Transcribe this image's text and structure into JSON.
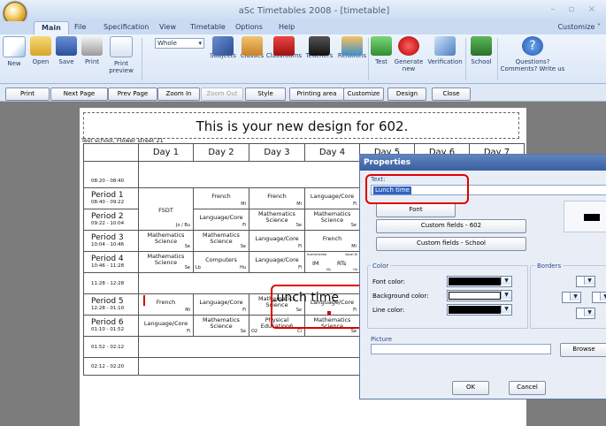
{
  "window": {
    "title": "aSc Timetables 2008  - [timetable]",
    "controls": "– ▫ ×"
  },
  "ribbon": {
    "tabs": [
      "Main",
      "File",
      "Specification",
      "View",
      "Timetable",
      "Options",
      "Help"
    ],
    "customize": "Customize ˅",
    "view_select": "Whole",
    "buttons": {
      "new": "New",
      "open": "Open",
      "save": "Save",
      "print": "Print",
      "print_preview": "Print preview",
      "subjects": "Subjects",
      "classes": "Classes",
      "classrooms": "Classrooms",
      "teachers": "Teachers",
      "relations": "Relations",
      "test": "Test",
      "generate_new": "Generate new",
      "verification": "Verification",
      "school": "School",
      "questions": "Questions? Comments? Write us"
    }
  },
  "print_toolbar": {
    "print": "Print",
    "next": "Next Page",
    "prev": "Prev Page",
    "zoom_in": "Zoom In",
    "zoom_out": "Zoom Out",
    "style": "Style",
    "printing_area": "Printing area",
    "customize": "Customize",
    "design": "Design",
    "close": "Close"
  },
  "page": {
    "headline": "This is your new design for 602.",
    "school": "Test school, Flower street 21",
    "days": [
      "Day 1",
      "Day 2",
      "Day 3",
      "Day 4",
      "Day 5",
      "Day 6",
      "Day 7"
    ],
    "rows": [
      {
        "name": "",
        "time": "08:20 - 08:40"
      },
      {
        "name": "Period 1",
        "time": "08:40 - 09:22"
      },
      {
        "name": "Period 2",
        "time": "09:22 - 10:04"
      },
      {
        "name": "Period 3",
        "time": "10:04 - 10:46"
      },
      {
        "name": "Period 4",
        "time": "10:46 - 11:28"
      },
      {
        "name": "",
        "time": "11:28 - 12:28"
      },
      {
        "name": "Period 5",
        "time": "12:28 - 01:10"
      },
      {
        "name": "Period 6",
        "time": "01:10 - 01:52"
      },
      {
        "name": "",
        "time": "01:52 - 02:12"
      },
      {
        "name": "",
        "time": "02:12 - 02:20"
      }
    ],
    "cells": {
      "fsdt": "FSDT",
      "fsdt_t": "Jo / Bu",
      "french": "French",
      "mi": "Mi",
      "fi": "Fi",
      "se": "Se",
      "lb": "Lb",
      "hu": "Hu",
      "o2": "O2",
      "ci": "Ci",
      "langcore": "Language/Core",
      "maths": "Mathematics Science",
      "computers": "Computers",
      "im": "IM",
      "rts": "RTs",
      "inst": "Instrumental",
      "vocal": "Vocal W",
      "my": "My",
      "ho": "Ho",
      "physed": "Physical Education6"
    },
    "lunch": "Lunch time"
  },
  "dialog": {
    "title": "Properties",
    "text_label": "Text:",
    "text_value": "Lunch time",
    "font_button": "Font",
    "custom_602": "Custom fields - 602",
    "custom_school": "Custom fields - School",
    "color_group": "Color",
    "borders_group": "Borders",
    "font_color": "Font color:",
    "background_color": "Background color:",
    "line_color": "Line color:",
    "picture_group": "Picture",
    "browse": "Browse",
    "ok": "OK",
    "cancel": "Cancel",
    "colors": {
      "font": "#000000",
      "background": "#ffffff",
      "line": "#000000"
    }
  }
}
